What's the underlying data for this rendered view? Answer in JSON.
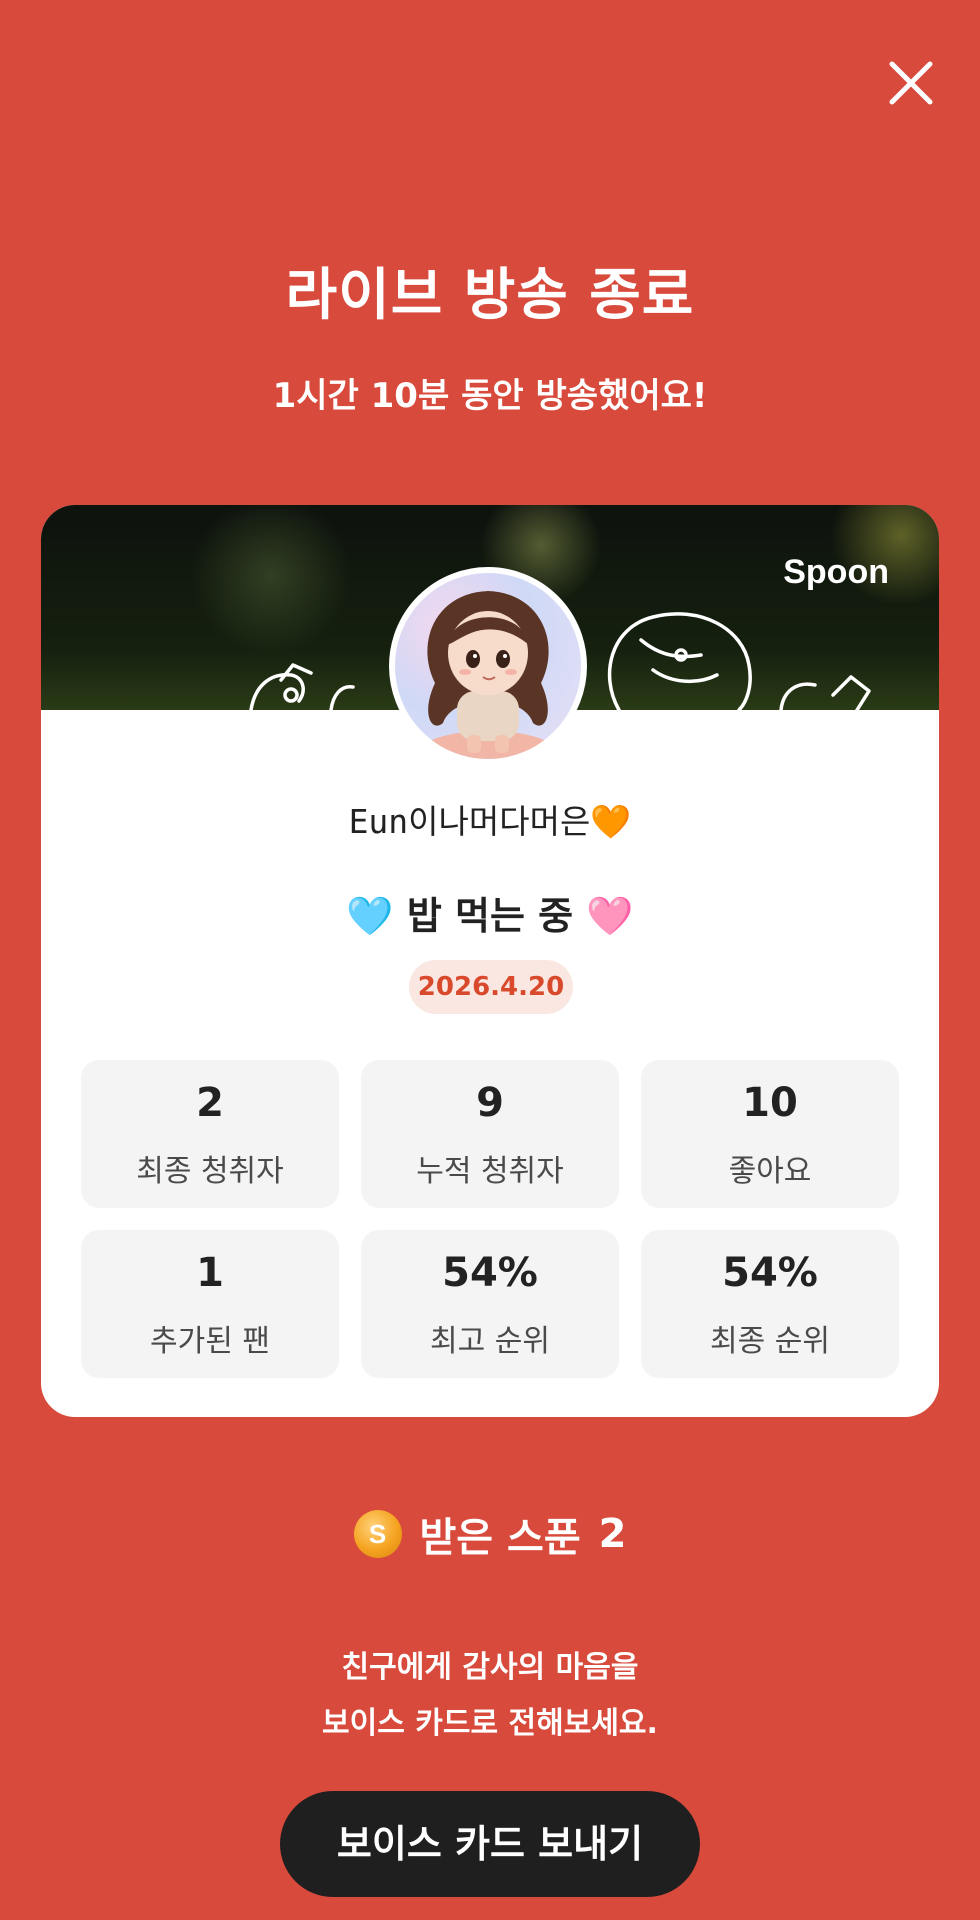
{
  "header": {
    "close_icon": "close-icon"
  },
  "title": "라이브 방송 종료",
  "subtitle": "1시간 10분 동안 방송했어요!",
  "card": {
    "brand": "Spoon",
    "nickname": "Eun이나머다머은🧡",
    "live_title": "🩵 밥 먹는 중 🩷",
    "date": "2026.4.20",
    "stats": [
      {
        "value": "2",
        "label": "최종 청취자"
      },
      {
        "value": "9",
        "label": "누적 청취자"
      },
      {
        "value": "10",
        "label": "좋아요"
      },
      {
        "value": "1",
        "label": "추가된 팬"
      },
      {
        "value": "54%",
        "label": "최고 순위"
      },
      {
        "value": "54%",
        "label": "최종 순위"
      }
    ]
  },
  "spoons": {
    "coin_letter": "S",
    "label": "받은 스푼",
    "count": "2"
  },
  "message": {
    "line1": "친구에게 감사의 마음을",
    "line2": "보이스 카드로 전해보세요."
  },
  "cta": {
    "label": "보이스 카드 보내기"
  },
  "colors": {
    "background": "#d84a3b",
    "card": "#ffffff",
    "date_pill_bg": "#fbe7e1",
    "date_text": "#d84a2b",
    "cta_bg": "#1f1f1f"
  }
}
